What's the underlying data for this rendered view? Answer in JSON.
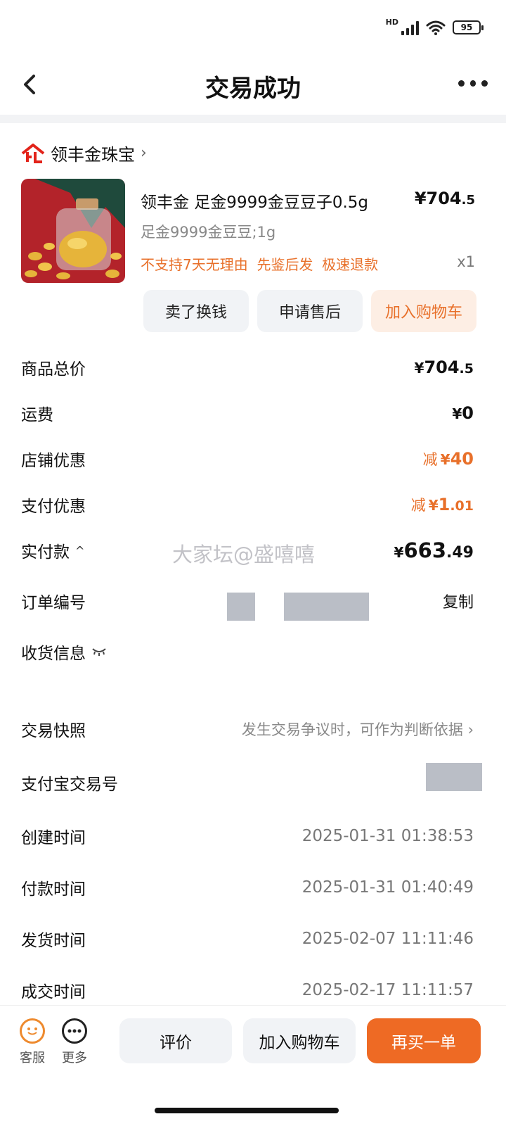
{
  "status_bar": {
    "hd": "HD",
    "battery": "95"
  },
  "header": {
    "title": "交易成功"
  },
  "shop": {
    "name": "领丰金珠宝"
  },
  "product": {
    "title": "领丰金 足金9999金豆豆子0.5g",
    "price_currency": "¥",
    "price_int": "704",
    "price_dec": ".5",
    "spec": "足金9999金豆豆;1g",
    "tags": "不支持7天无理由  先鉴后发  极速退款",
    "quantity": "x1",
    "actions": [
      "卖了换钱",
      "申请售后",
      "加入购物车"
    ]
  },
  "summary": {
    "total_label": "商品总价",
    "total_cur": "¥",
    "total_int": "704",
    "total_dec": ".5",
    "shipping_label": "运费",
    "shipping_cur": "¥",
    "shipping_int": "0",
    "shop_discount_label": "店铺优惠",
    "shop_discount_pre": "减",
    "shop_discount_cur": "¥",
    "shop_discount_int": "40",
    "pay_discount_label": "支付优惠",
    "pay_discount_pre": "减",
    "pay_discount_cur": "¥",
    "pay_discount_int": "1",
    "pay_discount_dec": ".01",
    "paid_label": "实付款",
    "paid_caret": "^",
    "paid_cur": "¥",
    "paid_int": "663",
    "paid_dec": ".49"
  },
  "watermark": "大家坛@盛嘻嘻",
  "order": {
    "number_label": "订单编号",
    "copy_label": "复制",
    "shipping_info_label": "收货信息",
    "snapshot_label": "交易快照",
    "snapshot_hint": "发生交易争议时，可作为判断依据",
    "alipay_label": "支付宝交易号",
    "times": [
      {
        "label": "创建时间",
        "value": "2025-01-31 01:38:53"
      },
      {
        "label": "付款时间",
        "value": "2025-01-31 01:40:49"
      },
      {
        "label": "发货时间",
        "value": "2025-02-07 11:11:46"
      },
      {
        "label": "成交时间",
        "value": "2025-02-17 11:11:57"
      }
    ]
  },
  "bottom_bar": {
    "service_label": "客服",
    "more_label": "更多",
    "review_label": "评价",
    "cart_label": "加入购物车",
    "rebuy_label": "再买一单"
  },
  "colors": {
    "accent": "#e8702a",
    "primary_button": "#ee6a24",
    "logo_red": "#e2231a"
  }
}
